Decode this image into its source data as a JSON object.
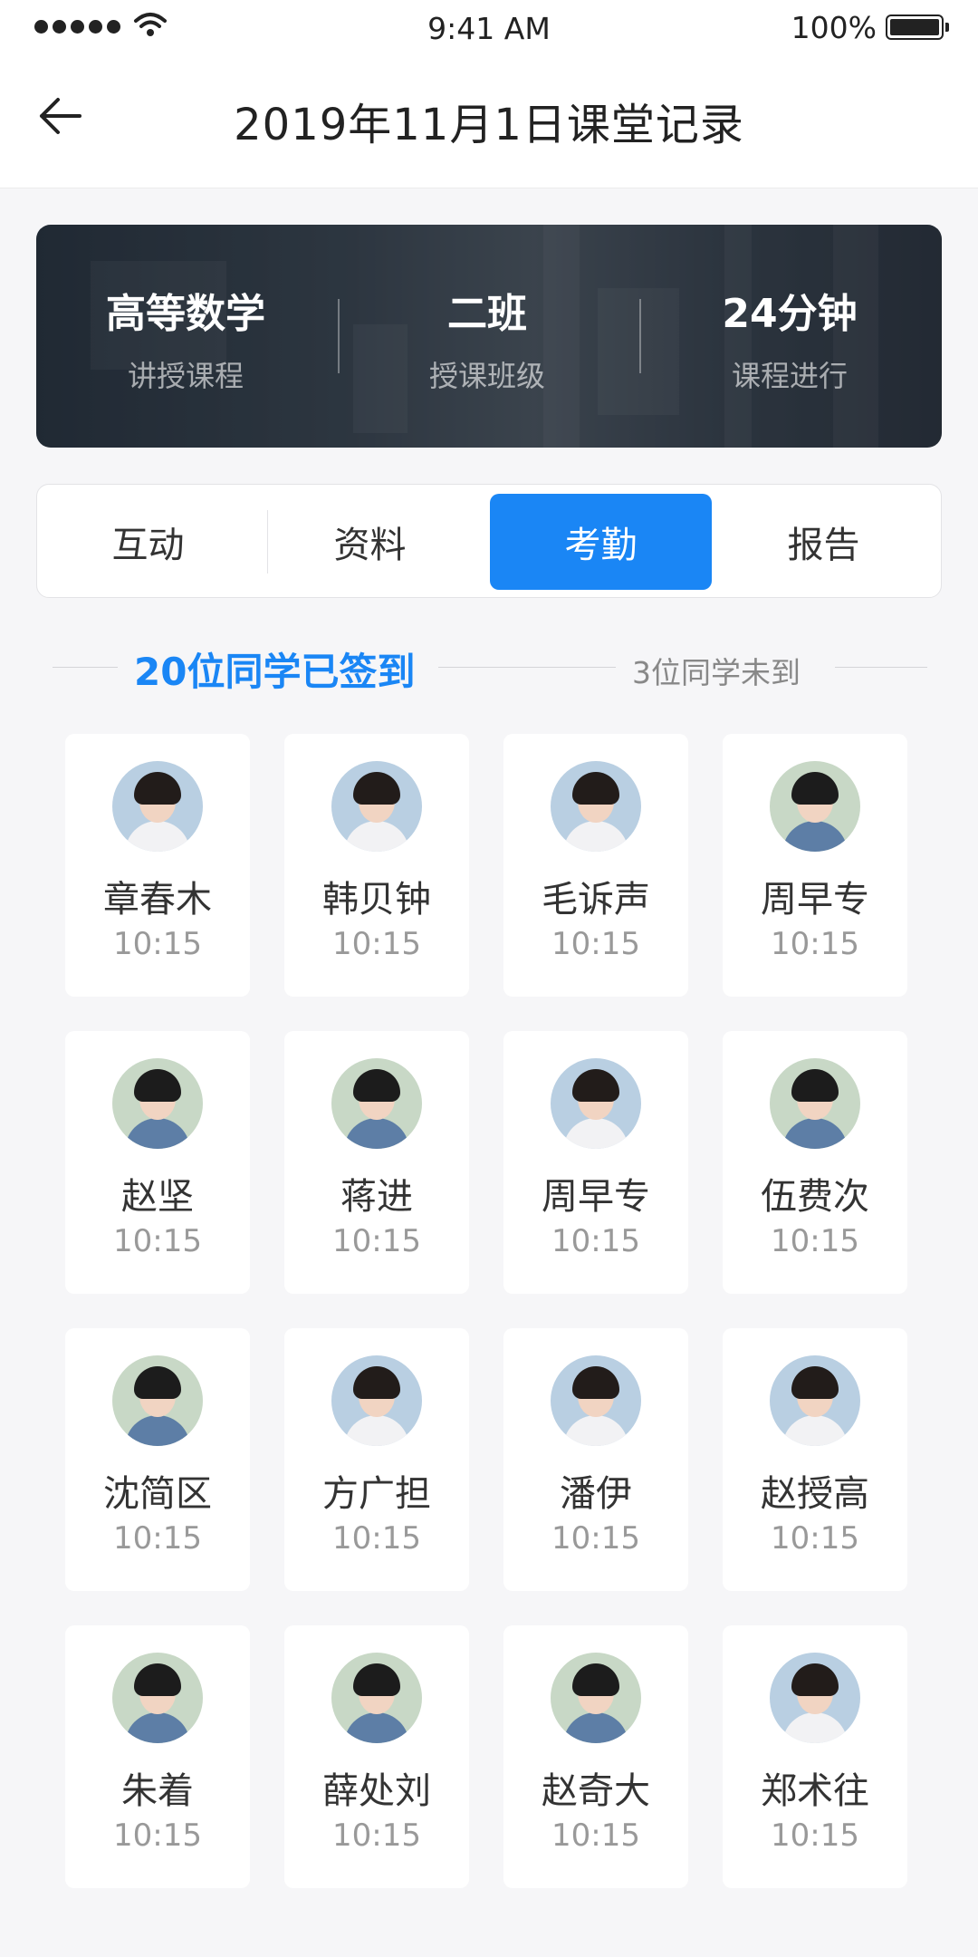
{
  "status_bar": {
    "time": "9:41 AM",
    "battery": "100%"
  },
  "header": {
    "title": "2019年11月1日课堂记录"
  },
  "banner": {
    "stats": [
      {
        "value": "高等数学",
        "label": "讲授课程"
      },
      {
        "value": "二班",
        "label": "授课班级"
      },
      {
        "value": "24分钟",
        "label": "课程进行"
      }
    ]
  },
  "tabs": [
    {
      "label": "互动",
      "active": false
    },
    {
      "label": "资料",
      "active": false
    },
    {
      "label": "考勤",
      "active": true
    },
    {
      "label": "报告",
      "active": false
    }
  ],
  "attendance": {
    "checked_in": "20位同学已签到",
    "absent": "3位同学未到"
  },
  "colors": {
    "accent": "#1a86f5",
    "background": "#f6f6f8"
  },
  "students": [
    {
      "name": "章春木",
      "time": "10:15",
      "avatar": "avatar-female"
    },
    {
      "name": "韩贝钟",
      "time": "10:15",
      "avatar": "avatar-female"
    },
    {
      "name": "毛诉声",
      "time": "10:15",
      "avatar": "avatar-female"
    },
    {
      "name": "周早专",
      "time": "10:15",
      "avatar": "avatar-male"
    },
    {
      "name": "赵坚",
      "time": "10:15",
      "avatar": "avatar-male"
    },
    {
      "name": "蒋进",
      "time": "10:15",
      "avatar": "avatar-male"
    },
    {
      "name": "周早专",
      "time": "10:15",
      "avatar": "avatar-female"
    },
    {
      "name": "伍费次",
      "time": "10:15",
      "avatar": "avatar-male"
    },
    {
      "name": "沈简区",
      "time": "10:15",
      "avatar": "avatar-male"
    },
    {
      "name": "方广担",
      "time": "10:15",
      "avatar": "avatar-female"
    },
    {
      "name": "潘伊",
      "time": "10:15",
      "avatar": "avatar-female"
    },
    {
      "name": "赵授高",
      "time": "10:15",
      "avatar": "avatar-female"
    },
    {
      "name": "朱着",
      "time": "10:15",
      "avatar": "avatar-male"
    },
    {
      "name": "薛处刘",
      "time": "10:15",
      "avatar": "avatar-male"
    },
    {
      "name": "赵奇大",
      "time": "10:15",
      "avatar": "avatar-male"
    },
    {
      "name": "郑术往",
      "time": "10:15",
      "avatar": "avatar-female"
    }
  ]
}
